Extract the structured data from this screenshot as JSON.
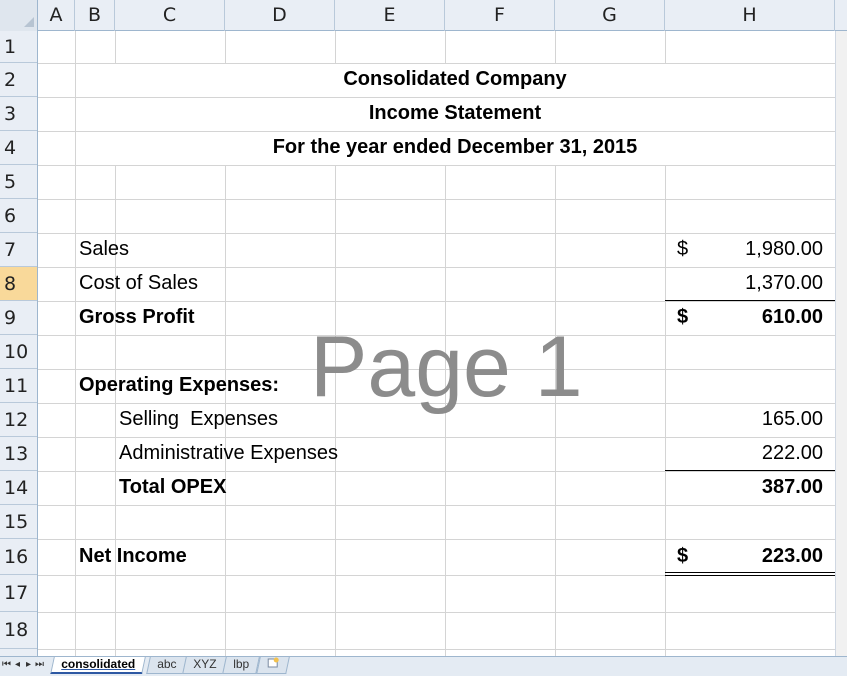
{
  "columns": [
    "A",
    "B",
    "C",
    "D",
    "E",
    "F",
    "G",
    "H"
  ],
  "rows": [
    "1",
    "2",
    "3",
    "4",
    "5",
    "6",
    "7",
    "8",
    "9",
    "10",
    "11",
    "12",
    "13",
    "14",
    "15",
    "16",
    "17",
    "18"
  ],
  "selected_row": "8",
  "header": {
    "company": "Consolidated Company",
    "statement": "Income Statement",
    "period": "For the year ended December 31, 2015"
  },
  "watermark": "Page 1",
  "lines": {
    "sales": {
      "label": "Sales",
      "currency": "$",
      "value": "1,980.00"
    },
    "cost_of_sales": {
      "label": "Cost of Sales",
      "value": "1,370.00"
    },
    "gross_profit": {
      "label": "Gross Profit",
      "currency": "$",
      "value": "610.00"
    },
    "opex_header": {
      "label": "Operating Expenses:"
    },
    "selling": {
      "label": "Selling  Expenses",
      "value": "165.00"
    },
    "admin": {
      "label": "Administrative Expenses",
      "value": "222.00"
    },
    "total_opex": {
      "label": "Total OPEX",
      "value": "387.00"
    },
    "net_income": {
      "label": "Net Income",
      "currency": "$",
      "value": "223.00"
    }
  },
  "sheet_tabs": {
    "active": "consolidated",
    "others": [
      "abc",
      "XYZ",
      "lbp"
    ]
  },
  "icons": [
    "first-sheet-nav-icon",
    "prev-sheet-nav-icon",
    "next-sheet-nav-icon",
    "last-sheet-nav-icon",
    "insert-sheet-icon"
  ]
}
